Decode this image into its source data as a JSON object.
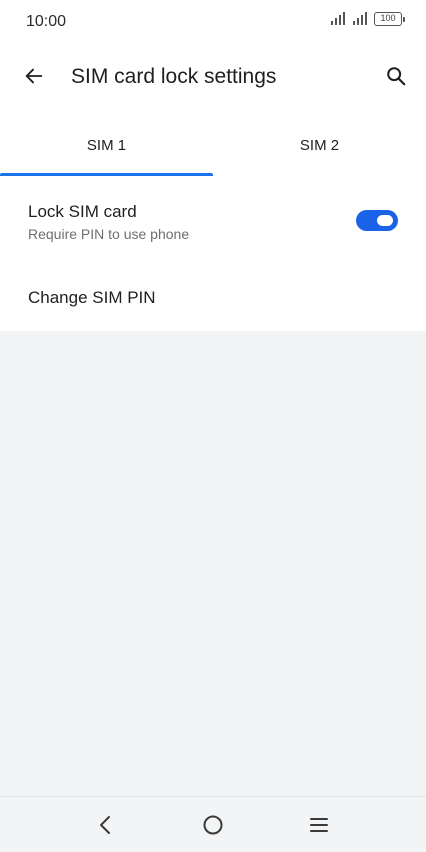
{
  "status_bar": {
    "time": "10:00",
    "battery_level": "100",
    "icons": [
      "signal-icon",
      "signal-icon",
      "battery-icon"
    ]
  },
  "app_bar": {
    "title": "SIM card lock settings",
    "back_icon": "arrow-left-icon",
    "search_icon": "search-icon"
  },
  "tabs": [
    {
      "label": "SIM 1",
      "selected": true
    },
    {
      "label": "SIM 2",
      "selected": false
    }
  ],
  "settings": {
    "lock_sim": {
      "title": "Lock SIM card",
      "subtitle": "Require PIN to use phone",
      "enabled": true
    },
    "change_pin": {
      "title": "Change SIM PIN"
    }
  },
  "nav_bar": {
    "icons": [
      "chevron-left-icon",
      "circle-home-icon",
      "menu-lines-icon"
    ]
  },
  "colors": {
    "accent": "#1a73e8",
    "toggle_on": "#1a63e8",
    "background": "#f3f4f6",
    "surface": "#ffffff"
  }
}
